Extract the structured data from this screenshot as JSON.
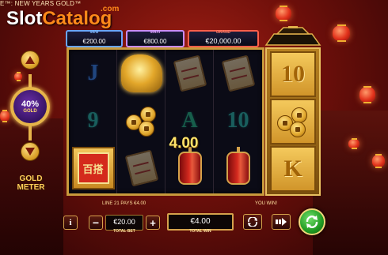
{
  "title_strip": "E™: NEW YEARS GOLD™",
  "logo": {
    "slot": "Slot",
    "catalog": "Catalog",
    "com": ".com"
  },
  "jackpots": {
    "mini": {
      "label": "MINI",
      "value": "€200.00",
      "color": "#6aa4ff"
    },
    "maxi": {
      "label": "MAXI",
      "value": "€800.00",
      "color": "#c98bff"
    },
    "grand": {
      "label": "GRAND",
      "value": "€20,000.00",
      "color": "#ff5e4a"
    }
  },
  "reels": [
    [
      "letter-j",
      "letter-9",
      "gold-box"
    ],
    [
      "golden-frog",
      "gold-coins",
      "scroll"
    ],
    [
      "scroll",
      "letter-a",
      "firecracker"
    ],
    [
      "scroll",
      "letter-10",
      "firecracker"
    ]
  ],
  "reel_letters": {
    "j": "J",
    "nine": "9",
    "a": "A",
    "ten": "10"
  },
  "gold_box_text": "百搭",
  "gold_panel": {
    "top": "10",
    "bottom": "K"
  },
  "win_amount": "4.00",
  "gold_meter": {
    "percent": "40%",
    "gold_label": "GOLD",
    "caption": "GOLD METER"
  },
  "bottom": {
    "line_info": "LINE 21 PAYS €4.00",
    "you_win": "YOU WIN!",
    "info_label": "i",
    "minus_label": "−",
    "plus_label": "+",
    "total_bet_value": "€20.00",
    "total_bet_caption": "TOTAL BET",
    "total_win_value": "€4.00",
    "total_win_caption": "TOTAL WIN"
  },
  "icons": [
    "up-arrow-icon",
    "down-arrow-icon",
    "autoplay-icon",
    "turbo-icon",
    "spin-icon"
  ],
  "accent_colors": {
    "gold": "#d5a24c",
    "spin_green": "#1f9a22",
    "win_yellow": "#ffe46a"
  }
}
